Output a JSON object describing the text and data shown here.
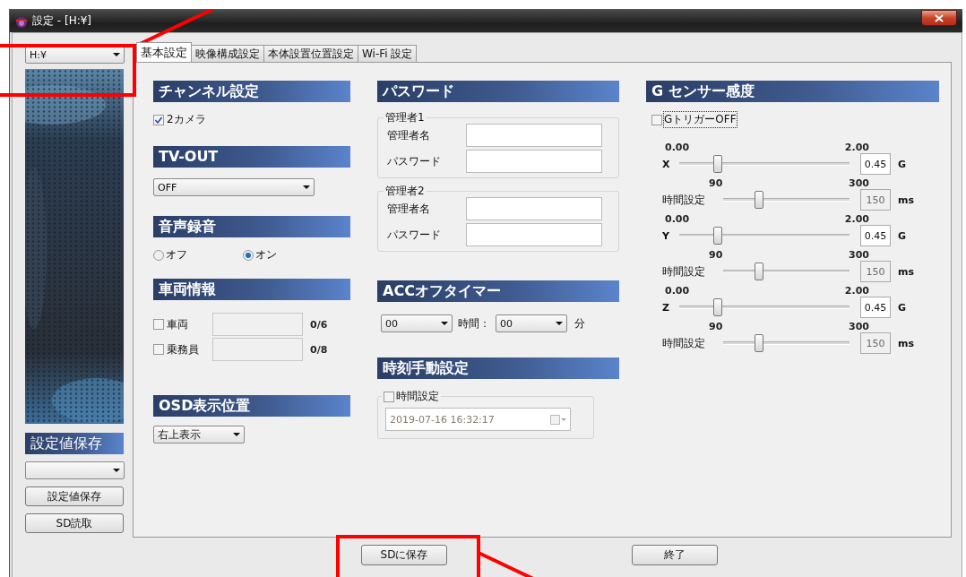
{
  "window": {
    "title": "設定 - [H:¥]"
  },
  "sidebar": {
    "drive": "H:¥",
    "save_heading": "設定値保存",
    "buttons": [
      "設定値保存",
      "SD読取"
    ]
  },
  "tabs": [
    {
      "label": "基本設定",
      "selected": true
    },
    {
      "label": "映像構成設定",
      "selected": false
    },
    {
      "label": "本体設置位置設定",
      "selected": false
    },
    {
      "label": "Wi-Fi 設定",
      "selected": false
    }
  ],
  "channel": {
    "heading": "チャンネル設定",
    "checkbox": {
      "label": "2カメラ",
      "checked": true
    }
  },
  "tv_out": {
    "heading": "TV-OUT",
    "value": "OFF"
  },
  "audio": {
    "heading": "音声録音",
    "options": [
      {
        "label": "オフ",
        "selected": false
      },
      {
        "label": "オン",
        "selected": true
      }
    ]
  },
  "vehicle": {
    "heading": "車両情報",
    "rows": [
      {
        "label": "車両",
        "checked": false,
        "count": "0/6"
      },
      {
        "label": "乗務員",
        "checked": false,
        "count": "0/8"
      }
    ]
  },
  "osd": {
    "heading": "OSD表示位置",
    "value": "右上表示"
  },
  "password": {
    "heading": "パスワード",
    "groups": [
      {
        "title": "管理者1",
        "fields": [
          "管理者名",
          "パスワード"
        ]
      },
      {
        "title": "管理者2",
        "fields": [
          "管理者名",
          "パスワード"
        ]
      }
    ]
  },
  "acc": {
    "heading": "ACCオフタイマー",
    "hours": "00",
    "hours_label": "時間：",
    "minutes": "00",
    "minutes_label": "分"
  },
  "clock": {
    "heading": "時刻手動設定",
    "checkbox": {
      "label": "時間設定",
      "checked": false
    },
    "value": "2019-07-16 16:32:17",
    "disabled": true
  },
  "gsensor": {
    "heading": "G センサー感度",
    "trigger": {
      "label": "GトリガーOFF",
      "checked": false
    },
    "axes": [
      {
        "axis": "X",
        "min": "0.00",
        "max": "2.00",
        "level": 0.225,
        "value": "0.45",
        "unit": "G",
        "time": {
          "label": "時間設定",
          "min": "90",
          "max": "300",
          "level": 0.286,
          "value": "150",
          "unit": "ms",
          "disabled": true
        }
      },
      {
        "axis": "Y",
        "min": "0.00",
        "max": "2.00",
        "level": 0.225,
        "value": "0.45",
        "unit": "G",
        "time": {
          "label": "時間設定",
          "min": "90",
          "max": "300",
          "level": 0.286,
          "value": "150",
          "unit": "ms",
          "disabled": true
        }
      },
      {
        "axis": "Z",
        "min": "0.00",
        "max": "2.00",
        "level": 0.225,
        "value": "0.45",
        "unit": "G",
        "time": {
          "label": "時間設定",
          "min": "90",
          "max": "300",
          "level": 0.286,
          "value": "150",
          "unit": "ms",
          "disabled": true
        }
      }
    ]
  },
  "footer": {
    "buttons": [
      "SDに保存",
      "終了"
    ]
  }
}
